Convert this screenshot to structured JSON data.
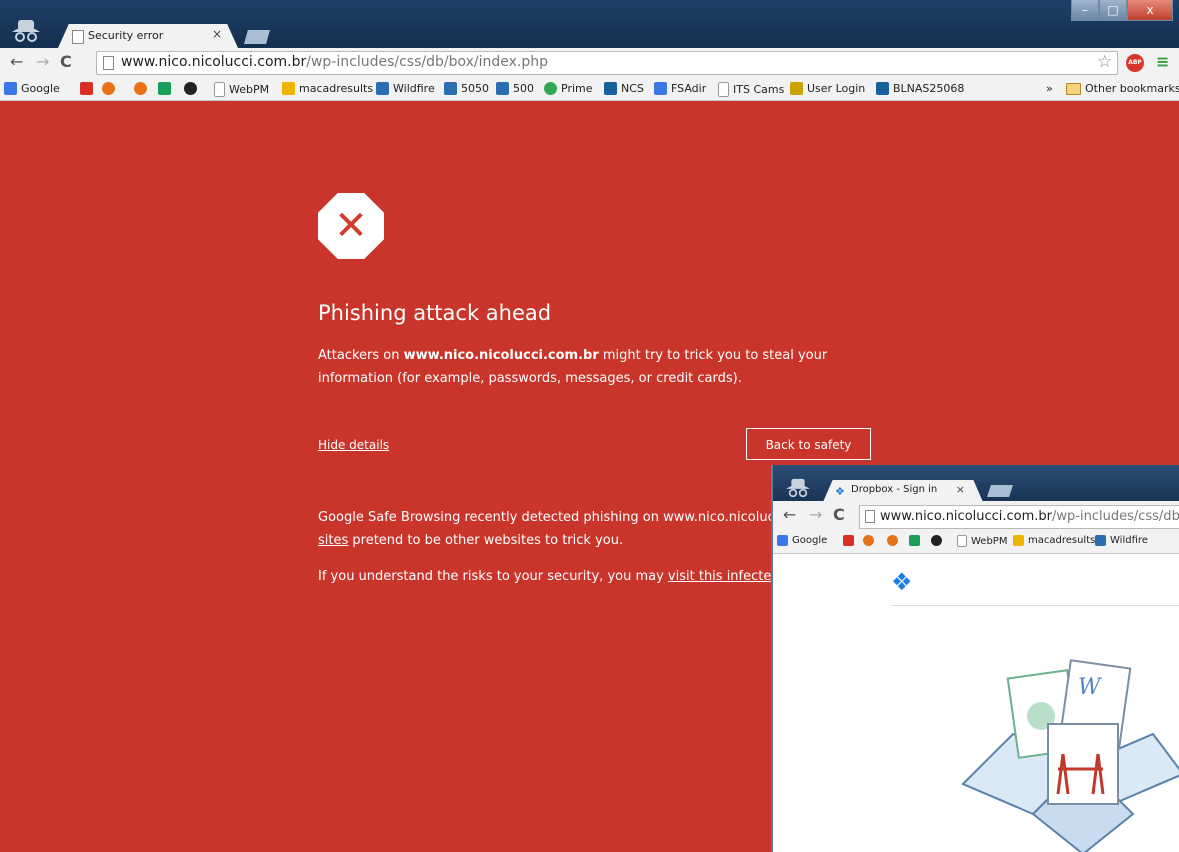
{
  "main_window": {
    "tab_title": "Security error",
    "tab_close": "×",
    "window_controls": [
      "–",
      "□",
      "x"
    ],
    "nav": {
      "back": "←",
      "forward": "→",
      "reload": "C"
    },
    "url": {
      "host": "www.nico.nicolucci.com.br",
      "path": "/wp-includes/css/db/box/index.php"
    },
    "toolbar_icons": {
      "star": "☆",
      "abp": "ABP",
      "menu": "≡"
    },
    "bookmarks": [
      {
        "label": "Google",
        "color": "#3b78e7"
      },
      {
        "label": "",
        "color": "#d93025"
      },
      {
        "label": "",
        "color": "#e8711a"
      },
      {
        "label": "",
        "color": "#e8711a"
      },
      {
        "label": "",
        "color": "#1a9f5a"
      },
      {
        "label": "",
        "color": "#222222"
      },
      {
        "label": "WebPM",
        "color": "#999999"
      },
      {
        "label": "macadresults",
        "color": "#f0b400"
      },
      {
        "label": "Wildfire",
        "color": "#2a6db0"
      },
      {
        "label": "5050",
        "color": "#2a6db0"
      },
      {
        "label": "500",
        "color": "#2a6db0"
      },
      {
        "label": "Prime",
        "color": "#33a852"
      },
      {
        "label": "NCS",
        "color": "#1a5fa0"
      },
      {
        "label": "FSAdir",
        "color": "#3b78e7"
      },
      {
        "label": "ITS Cams",
        "color": "#999999"
      },
      {
        "label": "User Login",
        "color": "#c9a400"
      },
      {
        "label": "BLNAS25068",
        "color": "#1a5fa0"
      }
    ],
    "bookmarks_overflow": "»",
    "other_bookmarks": "Other bookmarks"
  },
  "warning": {
    "icon": "✕",
    "heading": "Phishing attack ahead",
    "para1_prefix": "Attackers on ",
    "para1_host": "www.nico.nicolucci.com.br",
    "para1_suffix": " might try to trick you to steal your information (for example, passwords, messages, or credit cards).",
    "hide_details": "Hide details",
    "back_to_safety": "Back to safety",
    "para2_line1": "Google Safe Browsing recently detected phishing on www.nico.nicolucci.co",
    "para2_link": "sites",
    "para2_line2_rest": " pretend to be other websites to trick you.",
    "para3_prefix": "If you understand the risks to your security, you may ",
    "para3_link": "visit this infected site",
    "para3_suffix": "."
  },
  "popup_window": {
    "tab_title": "Dropbox - Sign in",
    "tab_close": "×",
    "nav": {
      "back": "←",
      "forward": "→",
      "reload": "C"
    },
    "url": {
      "host": "www.nico.nicolucci.com.br",
      "path": "/wp-includes/css/db/box/"
    },
    "bookmarks": [
      "Google",
      "",
      "",
      "",
      "",
      "",
      "WebPM",
      "macadresults",
      "Wildfire"
    ],
    "dropbox_logo": "❖"
  }
}
